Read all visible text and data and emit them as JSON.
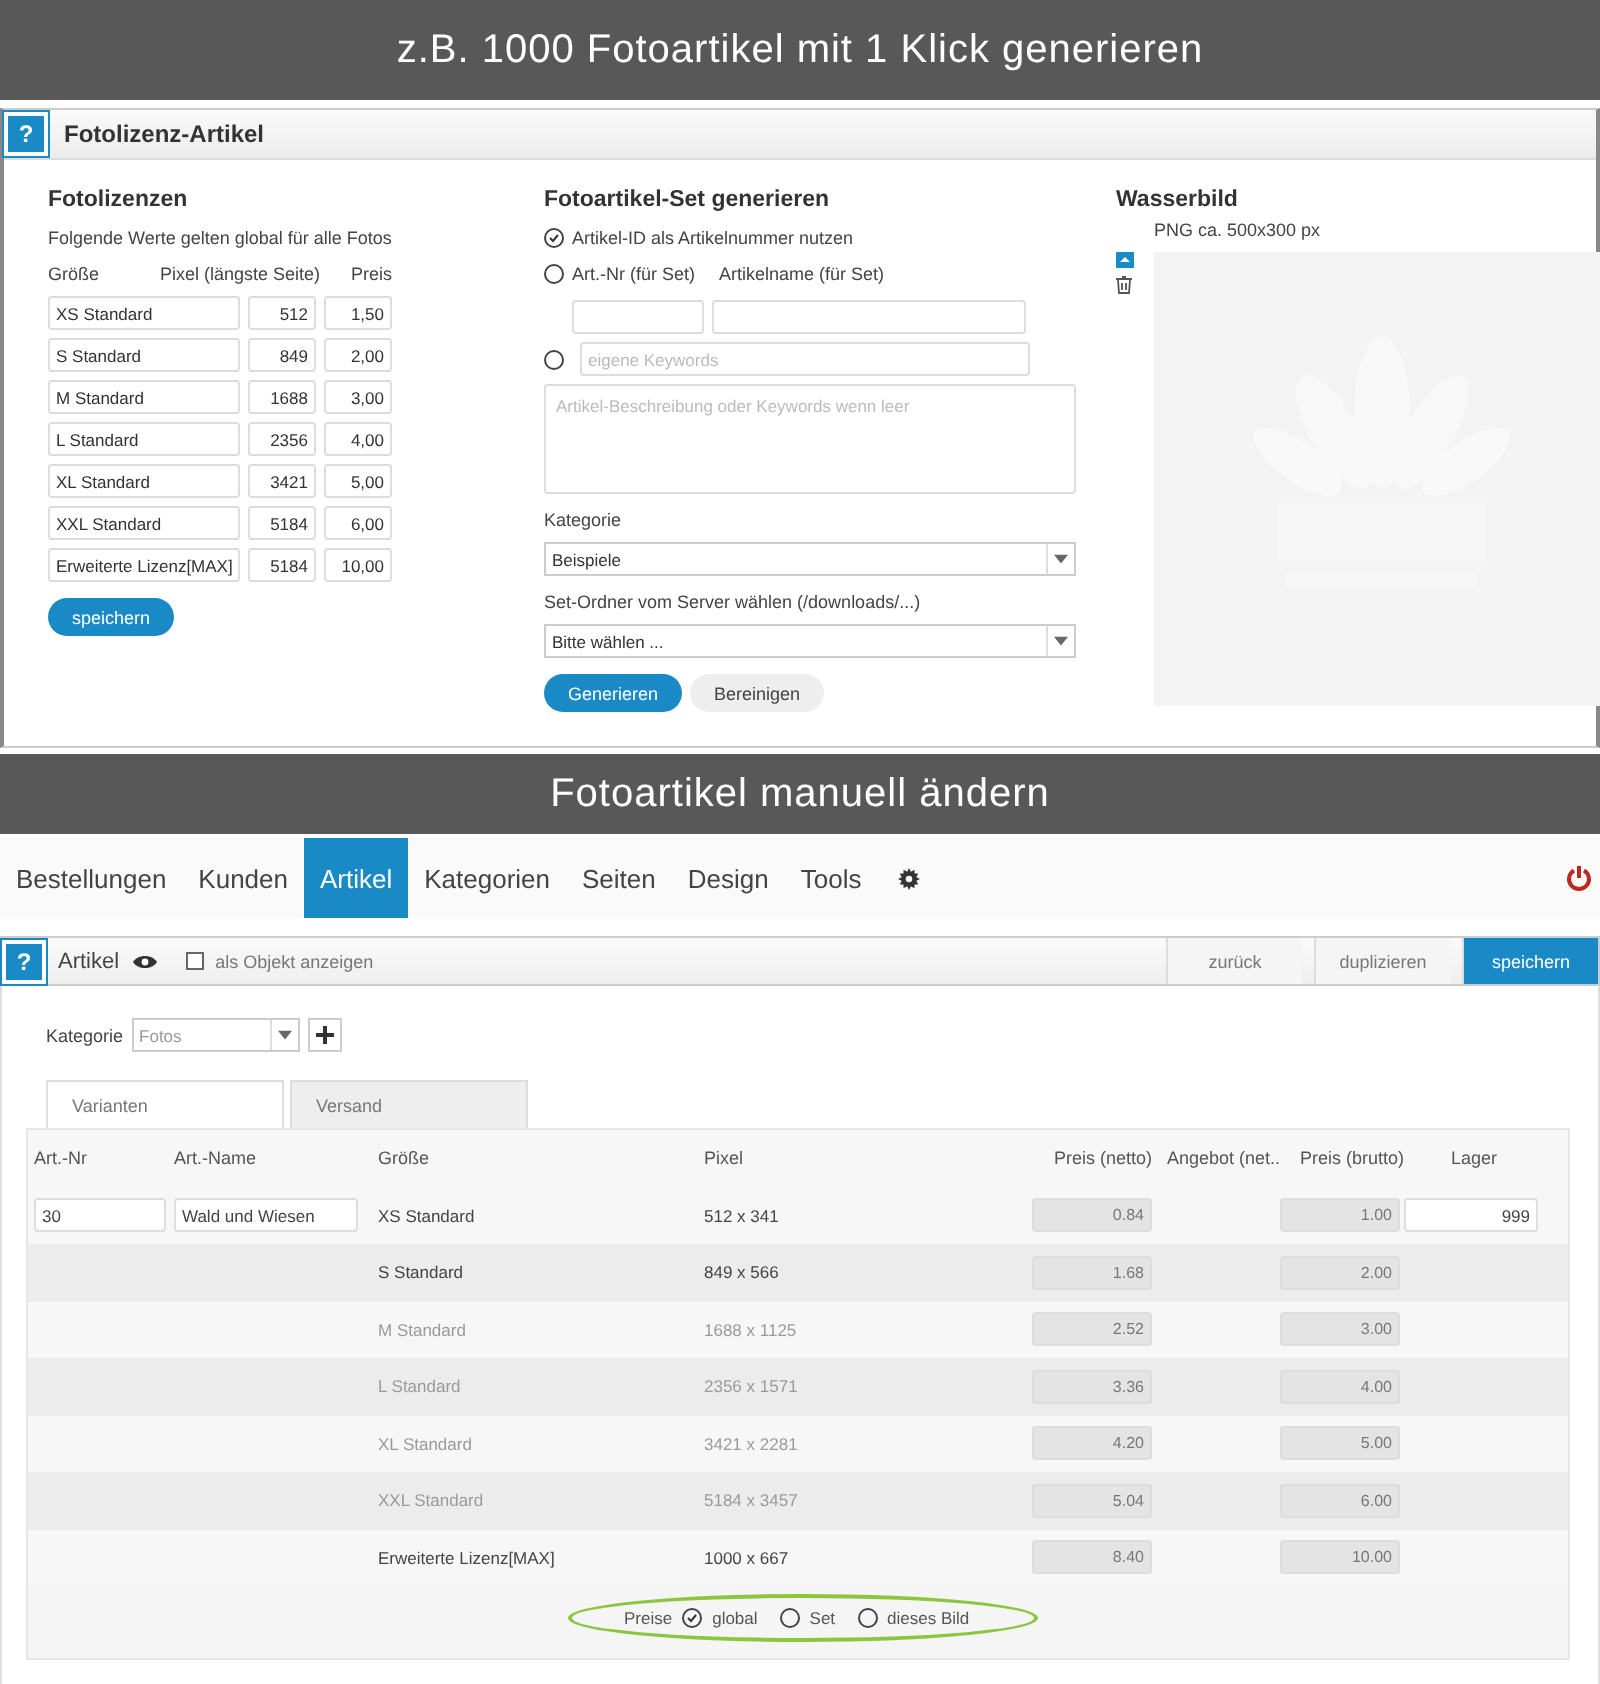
{
  "banner_top": "z.B. 1000 Fotoartikel mit 1 Klick generieren",
  "license_panel": {
    "help": "?",
    "title": "Fotolizenz-Artikel",
    "licenses": {
      "title": "Fotolizenzen",
      "note": "Folgende Werte gelten global für alle Fotos",
      "columns": [
        "Größe",
        "Pixel (längste Seite)",
        "Preis"
      ],
      "rows": [
        {
          "size": "XS Standard",
          "pixel": "512",
          "price": "1,50"
        },
        {
          "size": "S Standard",
          "pixel": "849",
          "price": "2,00"
        },
        {
          "size": "M Standard",
          "pixel": "1688",
          "price": "3,00"
        },
        {
          "size": "L Standard",
          "pixel": "2356",
          "price": "4,00"
        },
        {
          "size": "XL Standard",
          "pixel": "3421",
          "price": "5,00"
        },
        {
          "size": "XXL Standard",
          "pixel": "5184",
          "price": "6,00"
        },
        {
          "size": "Erweiterte Lizenz[MAX]",
          "pixel": "5184",
          "price": "10,00"
        }
      ],
      "save": "speichern"
    },
    "generate": {
      "title": "Fotoartikel-Set generieren",
      "options": [
        {
          "label": "Artikel-ID als Artikelnummer nutzen",
          "selected": true
        },
        {
          "label": "Art.-Nr (für Set)",
          "selected": false
        }
      ],
      "name_label": "Artikelname (für Set)",
      "keywords_selected": false,
      "keywords_placeholder": "eigene Keywords",
      "description_placeholder": "Artikel-Beschreibung oder Keywords wenn leer",
      "category_label": "Kategorie",
      "category_value": "Beispiele",
      "folder_label": "Set-Ordner vom Server wählen (/downloads/...)",
      "folder_value": "Bitte wählen ...",
      "buttons": [
        {
          "label": "Generieren",
          "kind": "primary"
        },
        {
          "label": "Bereinigen",
          "kind": "secondary"
        }
      ]
    },
    "watermark": {
      "title": "Wasserbild",
      "hint": "PNG ca. 500x300 px"
    }
  },
  "banner_middle": "Fotoartikel manuell ändern",
  "nav": [
    {
      "label": "Bestellungen",
      "selected": false
    },
    {
      "label": "Kunden",
      "selected": false
    },
    {
      "label": "Artikel",
      "selected": true
    },
    {
      "label": "Kategorien",
      "selected": false
    },
    {
      "label": "Seiten",
      "selected": false
    },
    {
      "label": "Design",
      "selected": false
    },
    {
      "label": "Tools",
      "selected": false
    }
  ],
  "toolbar": {
    "help": "?",
    "title": "Artikel",
    "object_label": "als Objekt anzeigen",
    "object_checked": false,
    "buttons": [
      {
        "label": "zurück",
        "kind": "secondary"
      },
      {
        "label": "duplizieren",
        "kind": "secondary"
      },
      {
        "label": "speichern",
        "kind": "primary"
      }
    ]
  },
  "article": {
    "category_label": "Kategorie",
    "category_value": "Fotos",
    "tabs": [
      {
        "label": "Varianten",
        "selected": true
      },
      {
        "label": "Versand",
        "selected": false
      }
    ],
    "columns": [
      "Art.-Nr",
      "Art.-Name",
      "Größe",
      "Pixel",
      "Preis (netto)",
      "Angebot (net..",
      "Preis (brutto)",
      "Lager"
    ],
    "rows": [
      {
        "art_nr": "30",
        "art_name": "Wald und Wiesen",
        "size": "XS Standard",
        "pixel": "512 x 341",
        "net": "0.84",
        "gross": "1.00",
        "stock": "999",
        "disabled": false
      },
      {
        "size": "S Standard",
        "pixel": "849 x 566",
        "net": "1.68",
        "gross": "2.00",
        "disabled": false
      },
      {
        "size": "M Standard",
        "pixel": "1688 x 1125",
        "net": "2.52",
        "gross": "3.00",
        "disabled": true
      },
      {
        "size": "L Standard",
        "pixel": "2356 x 1571",
        "net": "3.36",
        "gross": "4.00",
        "disabled": true
      },
      {
        "size": "XL Standard",
        "pixel": "3421 x 2281",
        "net": "4.20",
        "gross": "5.00",
        "disabled": true
      },
      {
        "size": "XXL Standard",
        "pixel": "5184 x 3457",
        "net": "5.04",
        "gross": "6.00",
        "disabled": true
      },
      {
        "size": "Erweiterte Lizenz[MAX]",
        "pixel": "1000 x 667",
        "net": "8.40",
        "gross": "10.00",
        "disabled": false
      }
    ],
    "prices_label": "Preise",
    "price_options": [
      {
        "label": "global",
        "selected": true
      },
      {
        "label": "Set",
        "selected": false
      },
      {
        "label": "dieses Bild",
        "selected": false
      }
    ]
  }
}
